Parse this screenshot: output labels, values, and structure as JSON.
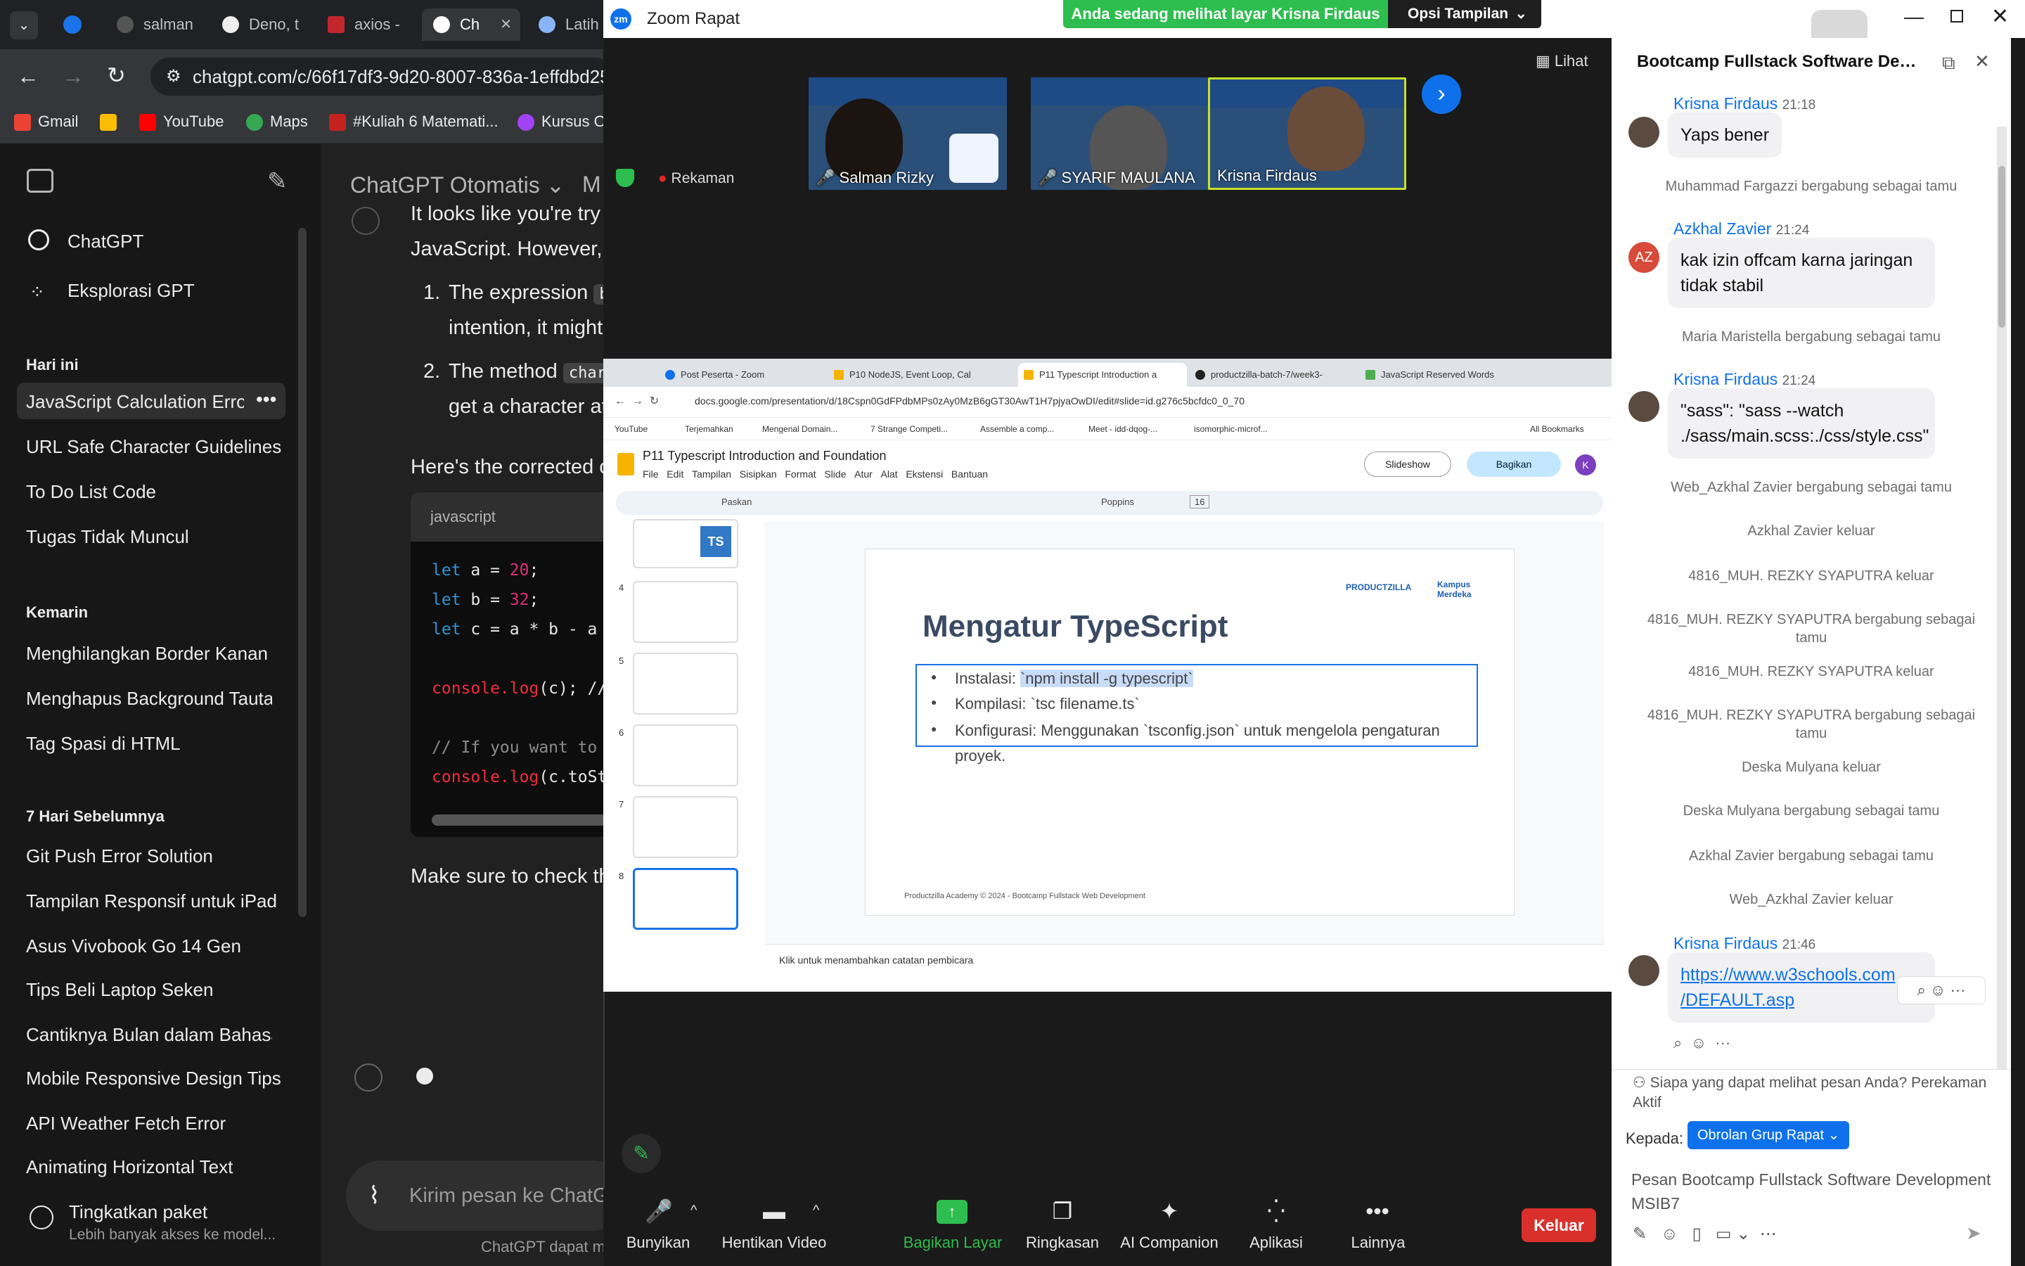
{
  "browser": {
    "tabs": [
      "salman",
      "Deno, t",
      "axios -",
      "Ch",
      "Latih"
    ],
    "url": "chatgpt.com/c/66f17df3-9d20-8007-836a-1effdbd25...",
    "bookmarks": [
      "Gmail",
      "YouTube",
      "Maps",
      "#Kuliah 6 Matemati...",
      "Kursus O"
    ]
  },
  "gpt": {
    "sidebar": {
      "items_top": [
        "ChatGPT",
        "Eksplorasi GPT"
      ],
      "section_today": "Hari ini",
      "today": [
        "JavaScript Calculation Error F",
        "URL Safe Character Guidelines",
        "To Do List Code",
        "Tugas Tidak Muncul"
      ],
      "section_yesterday": "Kemarin",
      "yesterday": [
        "Menghilangkan Border Kanan",
        "Menghapus Background Tautan",
        "Tag Spasi di HTML"
      ],
      "section_week": "7 Hari Sebelumnya",
      "week": [
        "Git Push Error Solution",
        "Tampilan Responsif untuk iPad",
        "Asus Vivobook Go 14 Gen",
        "Tips Beli Laptop Seken",
        "Cantiknya Bulan dalam Bahasa",
        "Mobile Responsive Design Tips",
        "API Weather Fetch Error",
        "Animating Horizontal Text"
      ],
      "upgrade_title": "Tingkatkan paket",
      "upgrade_sub": "Lebih banyak akses ke model..."
    },
    "header_title": "ChatGPT Otomatis",
    "header_more": "M",
    "message": {
      "line1": "It looks like you're try",
      "line2": "JavaScript. However, th",
      "item1_num": "1.",
      "item1_a": "The expression",
      "item1_code": "b",
      "item1_b": "intention, it might",
      "item2_num": "2.",
      "item2_a": "The method",
      "item2_code": "char",
      "item2_b": "get a character at",
      "corrected": "Here's the corrected c",
      "code_lang": "javascript",
      "code": {
        "l1_kw": "let",
        "l1_rest": " a = ",
        "l1_num": "20",
        "l1_end": ";",
        "l2_kw": "let",
        "l2_rest": " b = ",
        "l2_num": "32",
        "l2_end": ";",
        "l3_kw": "let",
        "l3_rest": " c = a * b - a",
        "l4_fn": "console.log",
        "l4_rest": "(c); //",
        "l5_cm": "// If you want to ",
        "l6_fn": "console.log",
        "l6_rest": "(c.toSt"
      },
      "closing": "Make sure to check th"
    },
    "composer_placeholder": "Kirim pesan ke ChatGP",
    "footer_note": "ChatGPT dapat me"
  },
  "zoom": {
    "window_title": "Zoom Rapat",
    "share_banner": "Anda sedang melihat layar Krisna Firdaus",
    "view_options": "Opsi Tampilan",
    "view_button": "Lihat",
    "recording": "Rekaman",
    "participants": [
      "Salman Rizky",
      "SYARIF MAULANA",
      "Krisna Firdaus"
    ],
    "toolbar": [
      "Bunyikan",
      "Hentikan Video",
      "Bagikan Layar",
      "Ringkasan",
      "AI Companion",
      "Aplikasi",
      "Lainnya"
    ],
    "leave": "Keluar",
    "colors": {
      "share_green": "#2ebe4f",
      "leave_red": "#d9302c",
      "zoom_blue": "#0e71eb"
    }
  },
  "shared": {
    "tabs": [
      "Post Peserta - Zoom",
      "P10 NodeJS, Event Loop, Cal",
      "P11 Typescript Introduction a",
      "productzilla-batch-7/week3-",
      "JavaScript Reserved Words"
    ],
    "url": "docs.google.com/presentation/d/18Cspn0GdFPdbMPs0zAy0MzB6gGT30AwT1H7pjyaOwDI/edit#slide=id.g276c5bcfdc0_0_70",
    "bookmarks": [
      "YouTube",
      "Terjemahkan",
      "Mengenal Domain...",
      "7 Strange Competi...",
      "Assemble a comp...",
      "Meet - idd-dqog-...",
      "isomorphic-microf...",
      "All Bookmarks"
    ],
    "doc_title": "P11 Typescript Introduction and Foundation",
    "menu": [
      "File",
      "Edit",
      "Tampilan",
      "Sisipkan",
      "Format",
      "Slide",
      "Atur",
      "Alat",
      "Ekstensi",
      "Bantuan"
    ],
    "slideshow": "Slideshow",
    "share": "Bagikan",
    "font": "Poppins",
    "font_size": "16",
    "fit": "Paskan",
    "thumb_numbers": [
      "4",
      "5",
      "6",
      "7",
      "8"
    ],
    "slide": {
      "title": "Mengatur TypeScript",
      "b1_a": "Instalasi: ",
      "b1_sel": "`npm install -g typescript`",
      "b2": "Kompilasi: `tsc filename.ts`",
      "b3": "Konfigurasi: Menggunakan `tsconfig.json` untuk mengelola pengaturan",
      "b3_cont": "proyek.",
      "footer": "Productzilla Academy © 2024 - Bootcamp Fullstack Web Development",
      "logo1": "PRODUCTZILLA",
      "logo2": "Kampus Merdeka"
    },
    "notes_placeholder": "Klik untuk menambahkan catatan pembicara"
  },
  "chat": {
    "title": "Bootcamp Fullstack Software Devel...",
    "messages": [
      {
        "name": "Krisna Firdaus",
        "time": "21:18",
        "text": "Yaps bener"
      },
      {
        "system": "Muhammad Fargazzi bergabung sebagai tamu"
      },
      {
        "name": "Azkhal Zavier",
        "time": "21:24",
        "text1": "kak izin offcam karna jaringan",
        "text2": "tidak stabil",
        "initials": "AZ"
      },
      {
        "system": "Maria Maristella bergabung sebagai tamu"
      },
      {
        "name": "Krisna Firdaus",
        "time": "21:24",
        "text1": "\"sass\": \"sass --watch",
        "text2": "./sass/main.scss:./css/style.css\""
      },
      {
        "system": "Web_Azkhal Zavier bergabung sebagai tamu"
      },
      {
        "system": "Azkhal Zavier keluar"
      },
      {
        "system": "4816_MUH. REZKY SYAPUTRA keluar"
      },
      {
        "system": "4816_MUH. REZKY SYAPUTRA bergabung sebagai tamu"
      },
      {
        "system": "4816_MUH. REZKY SYAPUTRA keluar"
      },
      {
        "system": "4816_MUH. REZKY SYAPUTRA bergabung sebagai tamu"
      },
      {
        "system": "Deska Mulyana keluar"
      },
      {
        "system": "Deska Mulyana bergabung sebagai tamu"
      },
      {
        "system": "Azkhal Zavier bergabung sebagai tamu"
      },
      {
        "system": "Web_Azkhal Zavier keluar"
      },
      {
        "name": "Krisna Firdaus",
        "time": "21:46",
        "text1": "https://www.w3schools.com",
        "text2": "/DEFAULT.asp"
      }
    ],
    "visibility_note": "Siapa yang dapat melihat pesan Anda? Perekaman Aktif",
    "to_label": "Kepada:",
    "to_value": "Obrolan Grup Rapat",
    "input_placeholder": "Pesan Bootcamp Fullstack Software Development MSIB7"
  }
}
